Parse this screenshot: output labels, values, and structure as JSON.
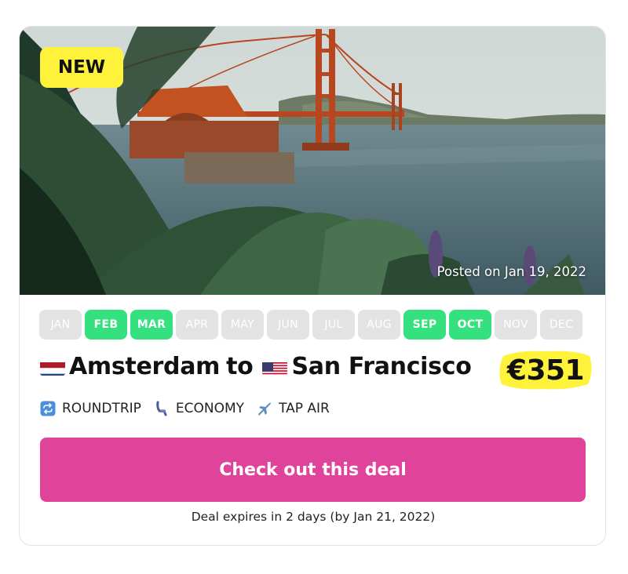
{
  "badge": "NEW",
  "posted": "Posted on Jan 19, 2022",
  "months": [
    {
      "label": "JAN",
      "active": false
    },
    {
      "label": "FEB",
      "active": true
    },
    {
      "label": "MAR",
      "active": true
    },
    {
      "label": "APR",
      "active": false
    },
    {
      "label": "MAY",
      "active": false
    },
    {
      "label": "JUN",
      "active": false
    },
    {
      "label": "JUL",
      "active": false
    },
    {
      "label": "AUG",
      "active": false
    },
    {
      "label": "SEP",
      "active": true
    },
    {
      "label": "OCT",
      "active": true
    },
    {
      "label": "NOV",
      "active": false
    },
    {
      "label": "DEC",
      "active": false
    }
  ],
  "route": {
    "origin": "Amsterdam",
    "origin_flag": "netherlands-flag-icon",
    "connector": "to",
    "destination": "San Francisco",
    "destination_flag": "usa-flag-icon"
  },
  "price": "€351",
  "meta": {
    "trip_type": "ROUNDTRIP",
    "trip_type_icon": "repeat-icon",
    "cabin": "ECONOMY",
    "cabin_icon": "seat-icon",
    "airline": "TAP AIR",
    "airline_icon": "airplane-icon"
  },
  "cta_label": "Check out this deal",
  "expires": "Deal expires in 2 days (by Jan 21, 2022)",
  "colors": {
    "active_month": "#35e07f",
    "inactive_month": "#e3e3e3",
    "cta": "#e0449a",
    "badge": "#fff23a",
    "price_highlight": "#fff23a"
  }
}
